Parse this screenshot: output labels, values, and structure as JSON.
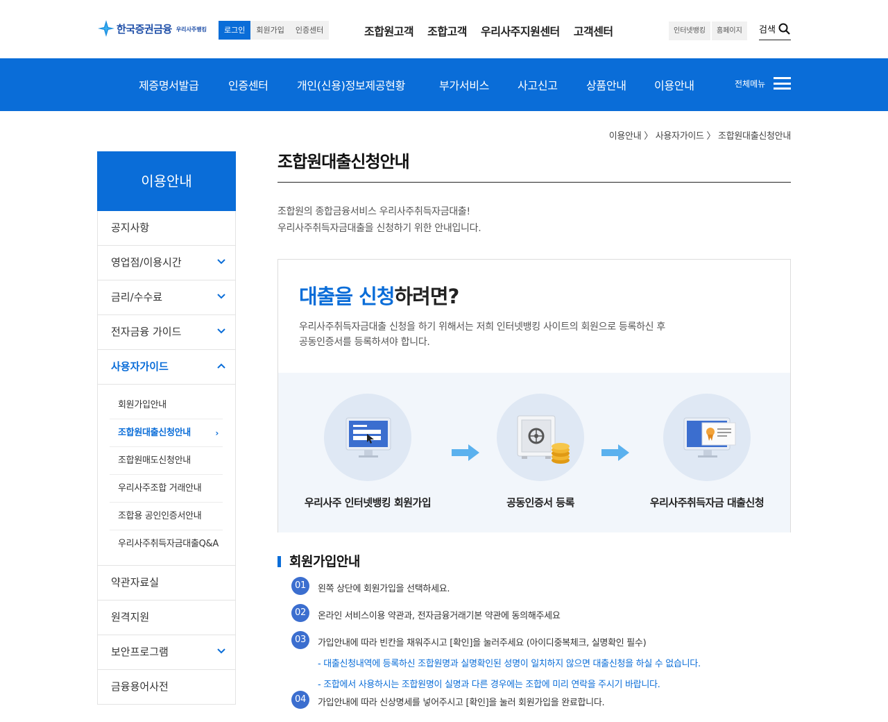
{
  "header": {
    "brand": {
      "name": "한국증권금융",
      "sub": "우리사주뱅킹"
    },
    "util_links": [
      "로그인",
      "회원가입",
      "인증센터"
    ],
    "gnb": [
      "조합원고객",
      "조합고객",
      "우리사주지원센터",
      "고객센터"
    ],
    "right_links": [
      "인터넷뱅킹",
      "홈페이지"
    ],
    "search_label": "검색"
  },
  "navbar": {
    "items": [
      "제증명서발급",
      "인증센터",
      "개인(신용)정보제공현황",
      "부가서비스",
      "사고신고",
      "상품안내",
      "이용안내"
    ],
    "all_menu": "전체메뉴"
  },
  "breadcrumb": "이용안내 〉 사용자가이드 〉 조합원대출신청안내",
  "sidebar": {
    "title": "이용안내",
    "items": [
      {
        "label": "공지사항"
      },
      {
        "label": "영업점/이용시간"
      },
      {
        "label": "금리/수수료"
      },
      {
        "label": "전자금융 가이드"
      },
      {
        "label": "사용자가이드"
      },
      {
        "label": "약관자료실"
      },
      {
        "label": "원격지원"
      },
      {
        "label": "보안프로그램"
      },
      {
        "label": "금융용어사전"
      }
    ],
    "sub_items": [
      "회원가입안내",
      "조합원대출신청안내",
      "조합원매도신청안내",
      "우리사주조합 거래안내",
      "조합용 공인인증서안내",
      "우리사주취득자금대출Q&A"
    ]
  },
  "main": {
    "title": "조합원대출신청안내",
    "intro_lines": [
      "조합원의 종합금융서비스 우리사주취득자금대출!",
      "우리사주취득자금대출을 신청하기 위한 안내입니다."
    ],
    "card": {
      "title_highlight": "대출을 신청",
      "title_rest": "하려면?",
      "desc_lines": [
        "우리사주취득자금대출 신청을 하기 위해서는 저희 인터넷뱅킹 사이트의 회원으로 등록하신 후",
        "공동인증서를 등록하셔야 합니다."
      ],
      "steps": [
        "우리사주 인터넷뱅킹 회원가입",
        "공동인증서 등록",
        "우리사주취득자금 대출신청"
      ]
    },
    "section_title": "회원가입안내",
    "guide": [
      {
        "num": "01",
        "text": "왼쪽 상단에 회원가입을 선택하세요."
      },
      {
        "num": "02",
        "text": "온라인 서비스이용 약관과, 전자금융거래기본 약관에 동의해주세요"
      },
      {
        "num": "03",
        "text": "가입안내에 따라 빈칸을 채워주시고 [확인]을 눌러주세요 (아이디중복체크, 실명확인 필수)"
      },
      {
        "num": "04",
        "text": "가입안내에 따라 신상명세를 넣어주시고 [확인]을 눌러 회원가입을 완료합니다."
      }
    ],
    "notes": [
      "대출신청내역에 등록하신 조합원명과 실명확인된 성명이 일치하지 않으면 대출신청을 하실 수 없습니다.",
      "조합에서 사용하시는 조합원명이 실명과 다른 경우에는 조합에 미리 연락을 주시기 바랍니다."
    ]
  },
  "colors": {
    "primary": "#0a6dd8",
    "step_num": "#3b6ecf",
    "step_bg": "#f2f6fb"
  },
  "icons": [
    "search-icon",
    "hamburger-icon",
    "chevron-down-icon",
    "chevron-up-icon",
    "chevron-right-icon",
    "monitor-login-icon",
    "safe-coins-icon",
    "monitor-certificate-icon",
    "arrow-right-icon"
  ]
}
